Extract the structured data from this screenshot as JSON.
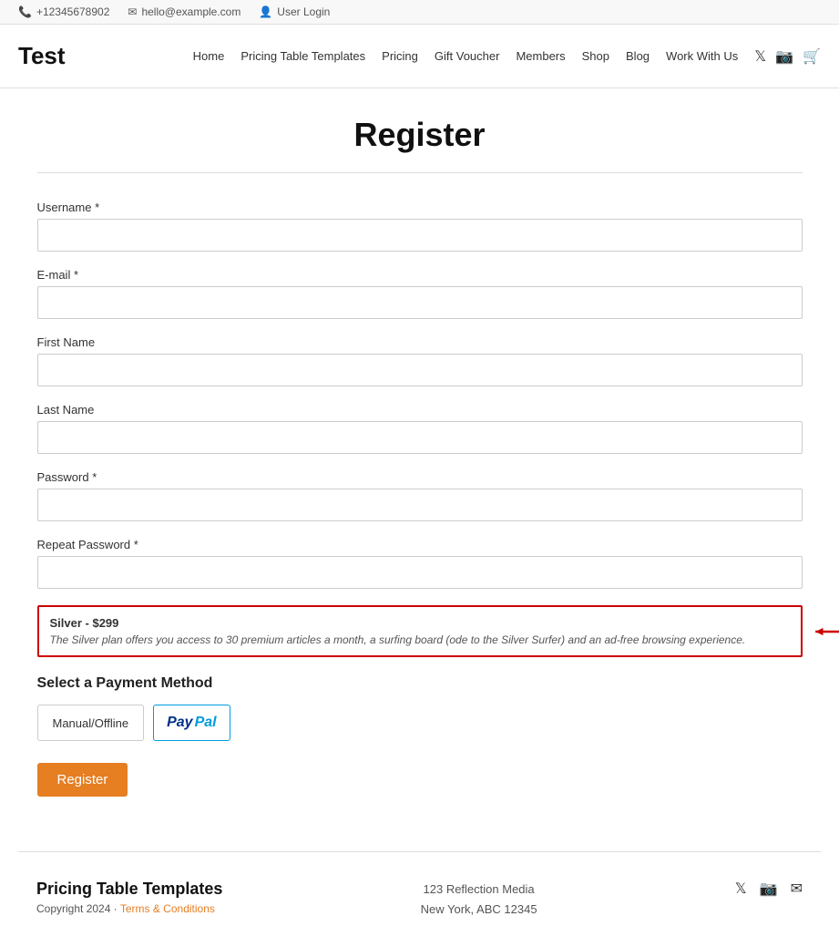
{
  "topbar": {
    "phone": "+12345678902",
    "email": "hello@example.com",
    "user_login": "User Login"
  },
  "header": {
    "logo": "Test",
    "nav": [
      {
        "label": "Home",
        "href": "#"
      },
      {
        "label": "Pricing Table Templates",
        "href": "#"
      },
      {
        "label": "Pricing",
        "href": "#"
      },
      {
        "label": "Gift Voucher",
        "href": "#"
      },
      {
        "label": "Members",
        "href": "#"
      },
      {
        "label": "Shop",
        "href": "#"
      },
      {
        "label": "Blog",
        "href": "#"
      },
      {
        "label": "Work With Us",
        "href": "#"
      }
    ]
  },
  "page": {
    "title": "Register"
  },
  "form": {
    "username_label": "Username *",
    "email_label": "E-mail *",
    "firstname_label": "First Name",
    "lastname_label": "Last Name",
    "password_label": "Password *",
    "repeat_password_label": "Repeat Password *"
  },
  "plan": {
    "title": "Silver - $299",
    "description": "The Silver plan offers you access to 30 premium articles a month, a surfing board (ode to the Silver Surfer) and an ad-free browsing experience."
  },
  "payment": {
    "section_title": "Select a Payment Method",
    "manual_label": "Manual/Offline",
    "paypal_label": "PayPal"
  },
  "register_button": "Register",
  "footer": {
    "brand": "Pricing Table Templates",
    "copyright": "Copyright 2024 ·",
    "terms_label": "Terms & Conditions",
    "address_line1": "123 Reflection Media",
    "address_line2": "New York, ABC 12345"
  }
}
